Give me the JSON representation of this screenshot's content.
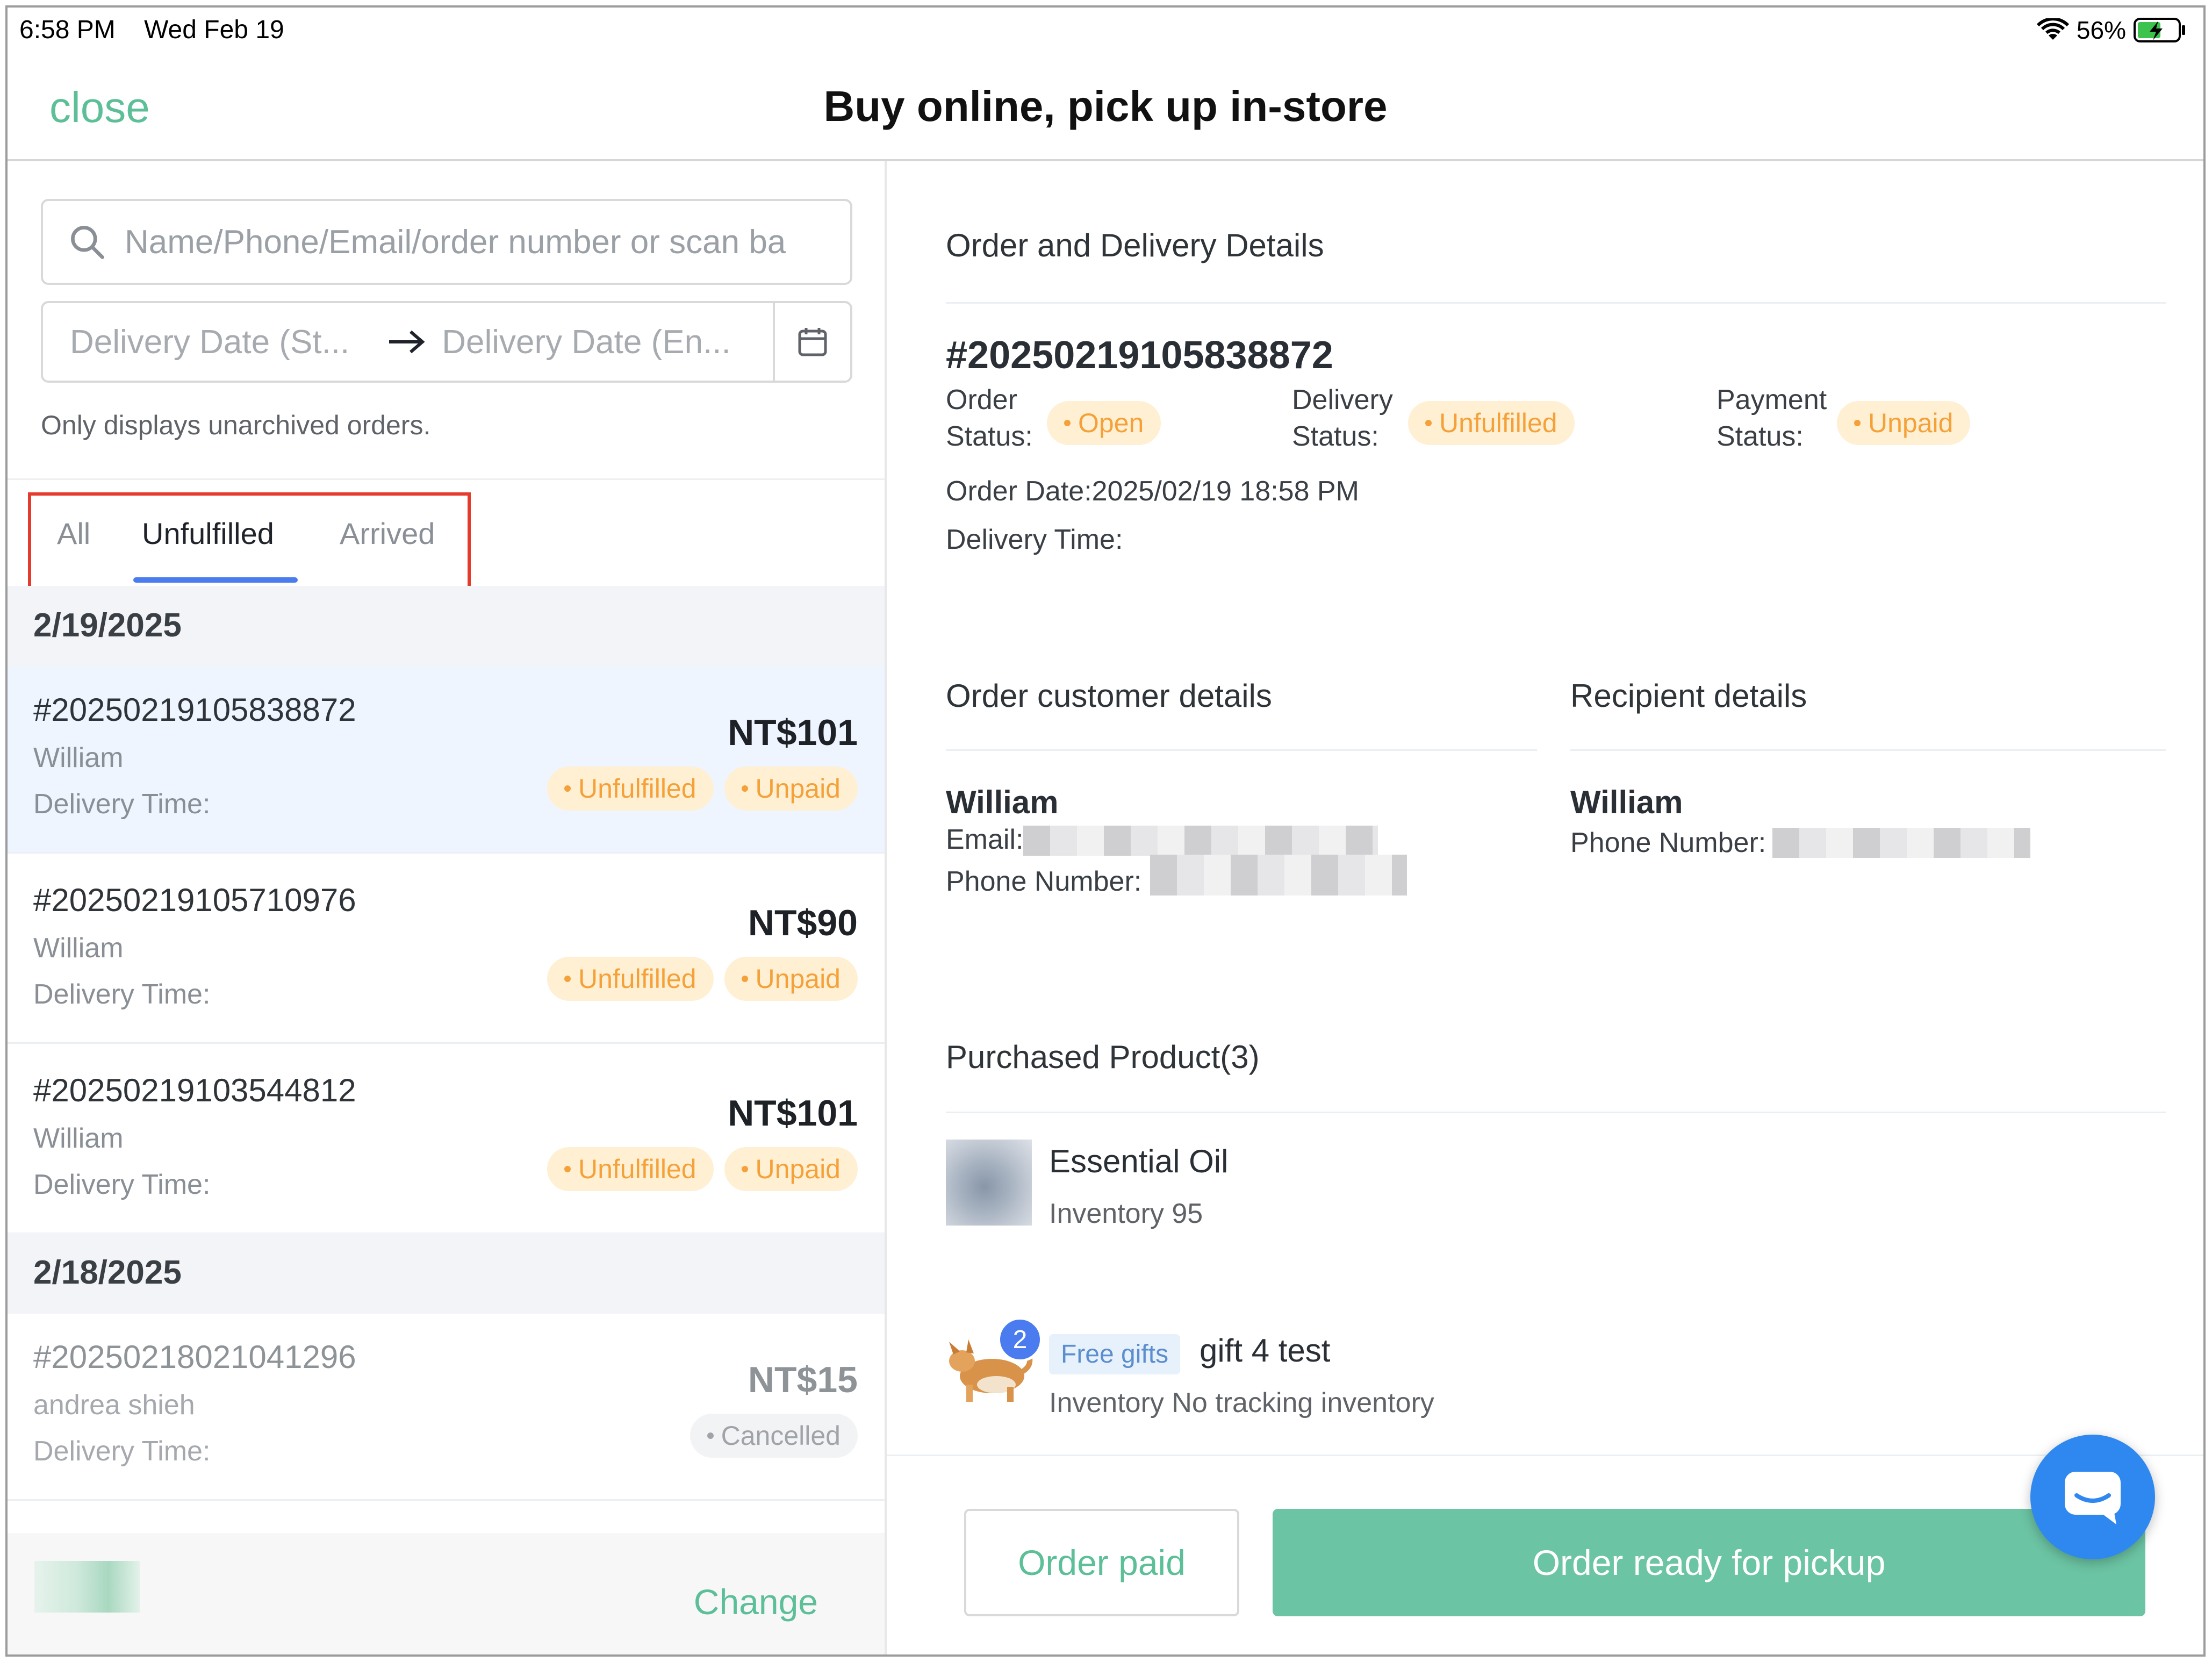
{
  "status_bar": {
    "time": "6:58 PM",
    "date": "Wed Feb 19",
    "battery": "56%"
  },
  "header": {
    "close_label": "close",
    "title": "Buy online, pick up in-store"
  },
  "filters": {
    "search_placeholder": "Name/Phone/Email/order number or scan ba",
    "date_start_placeholder": "Delivery Date (St...",
    "date_end_placeholder": "Delivery Date (En...",
    "note": "Only displays unarchived orders."
  },
  "tabs": [
    {
      "label": "All"
    },
    {
      "label": "Unfulfilled"
    },
    {
      "label": "Arrived"
    }
  ],
  "active_tab": "Unfulfilled",
  "order_groups": [
    {
      "date": "2/19/2025",
      "orders": [
        {
          "number": "#20250219105838872",
          "customer": "William",
          "delivery_time": "Delivery Time:",
          "price": "NT$101",
          "fulfillment": "Unfulfilled",
          "payment": "Unpaid"
        },
        {
          "number": "#20250219105710976",
          "customer": "William",
          "delivery_time": "Delivery Time:",
          "price": "NT$90",
          "fulfillment": "Unfulfilled",
          "payment": "Unpaid"
        },
        {
          "number": "#20250219103544812",
          "customer": "William",
          "delivery_time": "Delivery Time:",
          "price": "NT$101",
          "fulfillment": "Unfulfilled",
          "payment": "Unpaid"
        }
      ]
    },
    {
      "date": "2/18/2025",
      "orders": [
        {
          "number": "#20250218021041296",
          "customer": "andrea shieh",
          "delivery_time": "Delivery Time:",
          "price": "NT$15",
          "status": "Cancelled"
        }
      ]
    }
  ],
  "left_footer": {
    "change_label": "Change"
  },
  "details": {
    "section_title": "Order and Delivery Details",
    "order_number": "#20250219105838872",
    "order_status_label_1": "Order",
    "order_status_label_2": "Status:",
    "order_status": "Open",
    "delivery_status_label_1": "Delivery",
    "delivery_status_label_2": "Status:",
    "delivery_status": "Unfulfilled",
    "payment_status_label_1": "Payment",
    "payment_status_label_2": "Status:",
    "payment_status": "Unpaid",
    "order_date": "Order Date:2025/02/19 18:58 PM",
    "delivery_time": "Delivery Time:"
  },
  "customer": {
    "section_title": "Order customer details",
    "name": "William",
    "email_label": "Email:",
    "phone_label": "Phone Number:"
  },
  "recipient": {
    "section_title": "Recipient details",
    "name": "William",
    "phone_label": "Phone Number:"
  },
  "products": {
    "section_title": "Purchased Product(3)",
    "items": [
      {
        "name": "Essential Oil",
        "inventory": "Inventory 95"
      },
      {
        "tag": "Free gifts",
        "name": "gift 4 test",
        "inventory": "Inventory No tracking inventory",
        "quantity": "2"
      }
    ]
  },
  "actions": {
    "order_paid": "Order paid",
    "ready_for_pickup": "Order ready for pickup"
  },
  "colors": {
    "accent_green": "#5cbf98",
    "primary_button": "#6bc4a3",
    "tab_indicator": "#4a7cf0",
    "badge_orange": "#f5a13a",
    "highlight_red": "#e53b2c"
  }
}
